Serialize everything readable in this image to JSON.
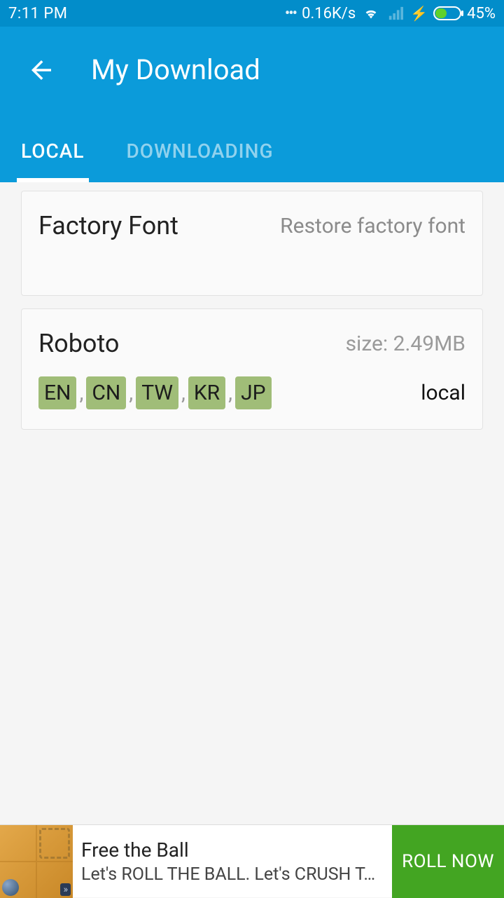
{
  "status": {
    "time": "7:11 PM",
    "speed": "0.16K/s",
    "battery_pct": "45%"
  },
  "header": {
    "title": "My Download"
  },
  "tabs": {
    "local": "LOCAL",
    "downloading": "DOWNLOADING"
  },
  "cards": {
    "factory": {
      "title": "Factory Font",
      "restore": "Restore factory font"
    },
    "roboto": {
      "title": "Roboto",
      "size": "size: 2.49MB",
      "status": "local",
      "langs": [
        "EN",
        "CN",
        "TW",
        "KR",
        "JP"
      ],
      "comma": ","
    }
  },
  "ad": {
    "title": "Free the Ball",
    "subtitle": "Let's ROLL THE BALL. Let's CRUSH T…",
    "button": "ROLL NOW"
  }
}
